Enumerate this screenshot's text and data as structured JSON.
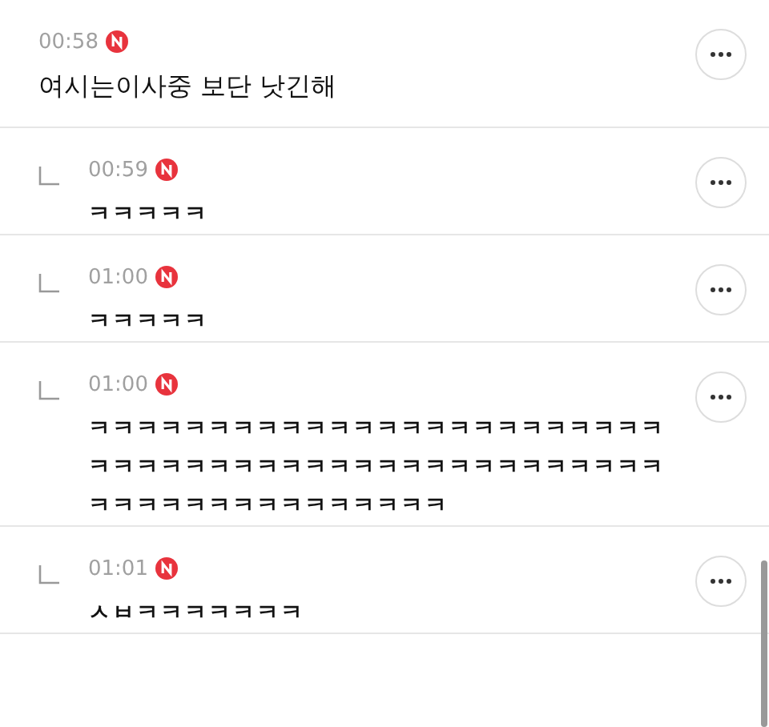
{
  "comments": [
    {
      "kind": "comment",
      "time": "00:58",
      "new": true,
      "text": "여시는이사중 보단 낫긴해"
    },
    {
      "kind": "reply",
      "time": "00:59",
      "new": true,
      "text": "ㅋㅋㅋㅋㅋ"
    },
    {
      "kind": "reply",
      "time": "01:00",
      "new": true,
      "text": "ㅋㅋㅋㅋㅋ"
    },
    {
      "kind": "reply",
      "time": "01:00",
      "new": true,
      "text": "ㅋㅋㅋㅋㅋㅋㅋㅋㅋㅋㅋㅋㅋㅋㅋㅋㅋㅋㅋㅋㅋㅋㅋㅋㅋㅋㅋㅋㅋㅋㅋㅋㅋㅋㅋㅋㅋㅋㅋㅋㅋㅋㅋㅋㅋㅋㅋㅋㅋㅋㅋㅋㅋㅋㅋㅋㅋㅋㅋㅋㅋㅋㅋ"
    },
    {
      "kind": "reply",
      "time": "01:01",
      "new": true,
      "text": "ㅅㅂㅋㅋㅋㅋㅋㅋㅋ"
    }
  ]
}
